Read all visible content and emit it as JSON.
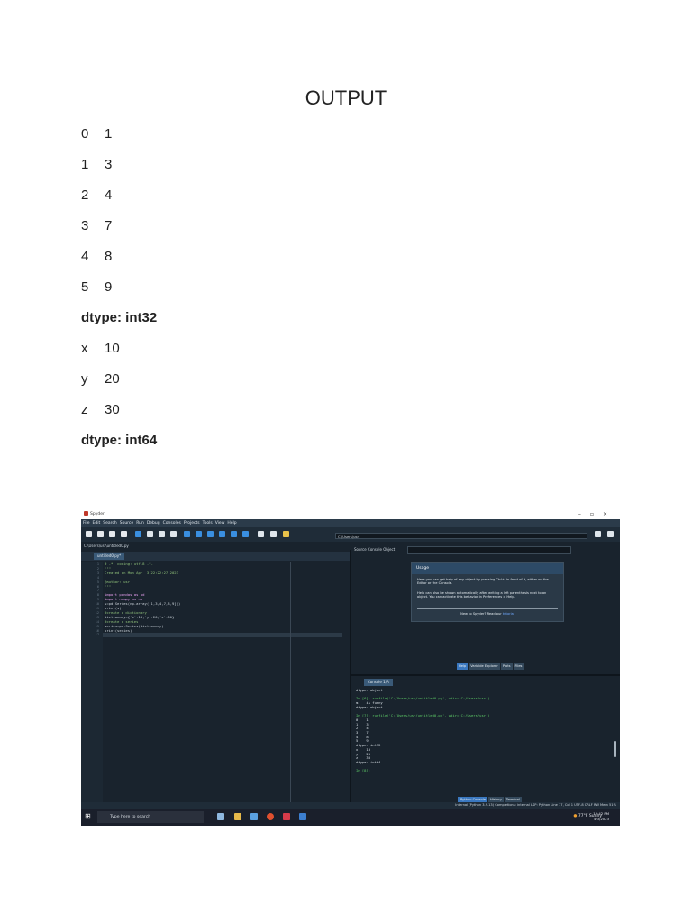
{
  "document": {
    "title": "OUTPUT",
    "output_lines": [
      {
        "left": "0",
        "right": "1"
      },
      {
        "left": "1",
        "right": "3"
      },
      {
        "left": "2",
        "right": "4"
      },
      {
        "left": "3",
        "right": "7"
      },
      {
        "left": "4",
        "right": "8"
      },
      {
        "left": "5",
        "right": "9"
      },
      {
        "text": "dtype: int32"
      },
      {
        "left": "x",
        "right": "10"
      },
      {
        "left": "y",
        "right": "20"
      },
      {
        "left": "z",
        "right": "30"
      },
      {
        "text": "dtype: int64"
      }
    ]
  },
  "screenshot": {
    "window_title": "Spyder",
    "menu": [
      "File",
      "Edit",
      "Search",
      "Source",
      "Run",
      "Debug",
      "Consoles",
      "Projects",
      "Tools",
      "View",
      "Help"
    ],
    "working_dir": "C:\\Users\\usr",
    "file_path": "C:\\Users\\usr\\untitled0.py",
    "editor_tab": "untitled0.py*",
    "code_lines": [
      "# -*- coding: utf-8 -*-",
      "\"\"\"",
      "Created on Mon Apr  3 22:22:27 2023",
      "",
      "@author: usr",
      "\"\"\"",
      "",
      "import pandas as pd",
      "import numpy as np",
      "s=pd.Series(np.array([1,3,4,7,8,9]))",
      "print(s)",
      "#create a dictionary",
      "dictionary={'x':10,'y':20,'z':30}",
      "#create a series",
      "series=pd.Series(dictionary)",
      "print(series)",
      ""
    ],
    "help": {
      "source_label": "Source",
      "console_option": "Console",
      "object_label": "Object",
      "usage_title": "Usage",
      "para1": "Here you can get help of any object by pressing Ctrl+I in front of it, either on the Editor or the Console.",
      "para2": "Help can also be shown automatically after writing a left parenthesis next to an object. You can activate this behavior in Preferences > Help.",
      "new_prefix": "New to Spyder? Read our",
      "tutorial_link": "tutorial",
      "tabs": [
        "Help",
        "Variable Explorer",
        "Plots",
        "Files"
      ]
    },
    "console": {
      "tab": "Console 1/A",
      "lines": [
        {
          "t": "dtype: object",
          "g": false
        },
        {
          "t": "",
          "g": false
        },
        {
          "t": "In [6]: runfile('C:/Users/usr/untitled0.py', wdir='C:/Users/usr')",
          "g": true
        },
        {
          "t": "m    is funny",
          "g": false
        },
        {
          "t": "dtype: object",
          "g": false
        },
        {
          "t": "",
          "g": false
        },
        {
          "t": "In [7]: runfile('C:/Users/usr/untitled0.py', wdir='C:/Users/usr')",
          "g": true
        },
        {
          "t": "0    1",
          "g": false
        },
        {
          "t": "1    3",
          "g": false
        },
        {
          "t": "2    4",
          "g": false
        },
        {
          "t": "3    7",
          "g": false
        },
        {
          "t": "4    8",
          "g": false
        },
        {
          "t": "5    9",
          "g": false
        },
        {
          "t": "dtype: int32",
          "g": false
        },
        {
          "t": "x    10",
          "g": false
        },
        {
          "t": "y    20",
          "g": false
        },
        {
          "t": "z    30",
          "g": false
        },
        {
          "t": "dtype: int64",
          "g": false
        },
        {
          "t": "",
          "g": false
        },
        {
          "t": "In [8]:",
          "g": true
        }
      ],
      "tabs": [
        "IPython Console",
        "History",
        "Terminal"
      ]
    },
    "status": "Internal (Python 3.9.13)   Completions: internal   LSP: Python   Line 17, Col 1   UTF-8   CRLF   RW   Mem 51%",
    "taskbar": {
      "search_placeholder": "Type here to search",
      "weather": "77°F Sunny",
      "time": "12:42 PM",
      "date": "4/3/2023"
    }
  }
}
